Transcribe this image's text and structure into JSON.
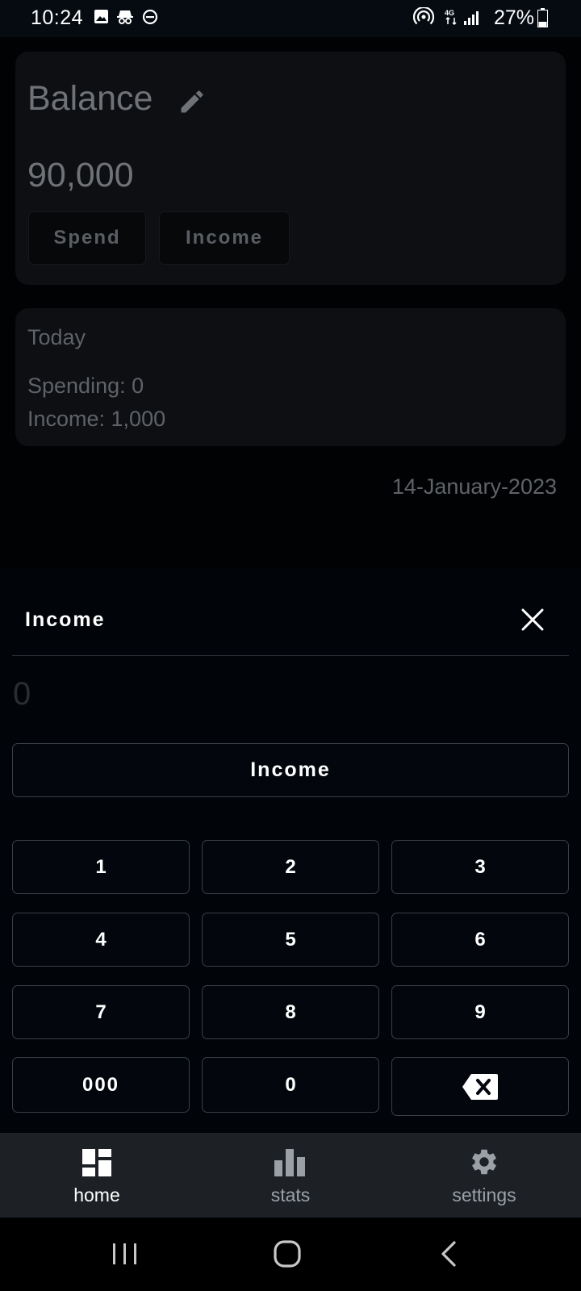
{
  "status_bar": {
    "time": "10:24",
    "battery": "27%",
    "network": "4G"
  },
  "balance": {
    "title": "Balance",
    "amount": "90,000",
    "spend_label": "Spend",
    "income_label": "Income"
  },
  "today": {
    "title": "Today",
    "spending": "Spending: 0",
    "income": "Income: 1,000",
    "date": "14-January-2023"
  },
  "sheet": {
    "title": "Income",
    "amount": "0",
    "submit_label": "Income",
    "keys": [
      "1",
      "2",
      "3",
      "4",
      "5",
      "6",
      "7",
      "8",
      "9",
      "000",
      "0"
    ]
  },
  "nav": {
    "items": [
      {
        "label": "home",
        "icon": "dashboard-icon",
        "active": true
      },
      {
        "label": "stats",
        "icon": "bar-chart-icon",
        "active": false
      },
      {
        "label": "settings",
        "icon": "gear-icon",
        "active": false
      }
    ]
  },
  "colors": {
    "active_nav": "#ffffff",
    "inactive_nav": "#9aa0a6",
    "sheet_bg": "#010409",
    "button_border": "#3a3f46"
  }
}
